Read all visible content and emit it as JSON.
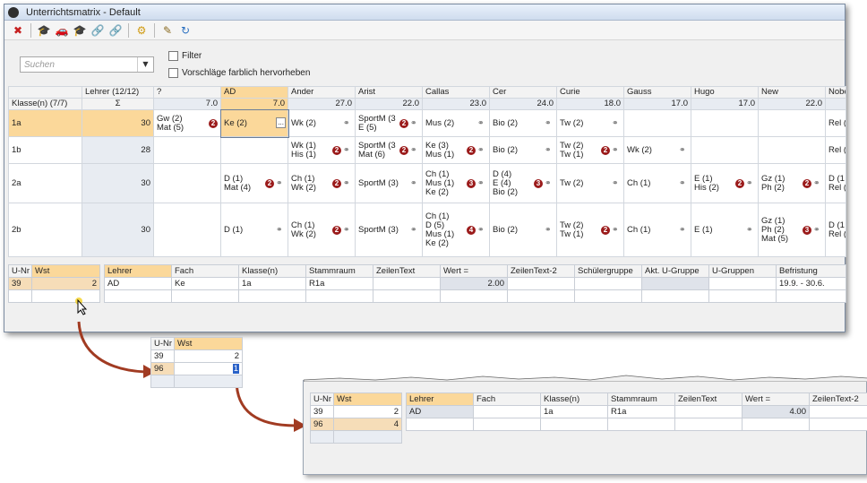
{
  "window": {
    "title": "Unterrichtsmatrix - Default"
  },
  "toolbar": {
    "icons": [
      "delete-icon",
      "graduation-cap-icon",
      "car-icon",
      "graduation-cap-icon",
      "link-icon",
      "link-disabled-icon",
      "settings-gear-icon",
      "edit-icon",
      "refresh-icon"
    ]
  },
  "search": {
    "placeholder": "Suchen"
  },
  "options": {
    "filter": "Filter",
    "highlight": "Vorschläge farblich hervorheben"
  },
  "matrix": {
    "corner": "Klasse(n) (7/7)",
    "lehrer_header": "Lehrer (12/12)",
    "sigma": "Σ",
    "columns": [
      {
        "name": "?",
        "sum": "7.0"
      },
      {
        "name": "AD",
        "sum": "7.0"
      },
      {
        "name": "Ander",
        "sum": "27.0"
      },
      {
        "name": "Arist",
        "sum": "22.0"
      },
      {
        "name": "Callas",
        "sum": "23.0"
      },
      {
        "name": "Cer",
        "sum": "24.0"
      },
      {
        "name": "Curie",
        "sum": "18.0"
      },
      {
        "name": "Gauss",
        "sum": "17.0"
      },
      {
        "name": "Hugo",
        "sum": "17.0"
      },
      {
        "name": "New",
        "sum": "22.0"
      },
      {
        "name": "Nobel",
        "sum": ""
      }
    ],
    "rows": [
      {
        "name": "1a",
        "sum": "30",
        "cells": [
          "Gw (2)\nMat (5)",
          "Ke (2)",
          "Wk (2)",
          "SportM (3\nE (5)",
          "Mus (2)",
          "Bio (2)",
          "Tw (2)",
          "",
          "",
          "",
          "Rel ("
        ]
      },
      {
        "name": "1b",
        "sum": "28",
        "cells": [
          "",
          "",
          "Wk (1)\nHis (1)",
          "SportM (3\nMat (6)",
          "Ke (3)\nMus (1)",
          "Bio (2)",
          "Tw (2)\nTw (1)",
          "Wk (2)",
          "",
          "",
          "Rel ("
        ]
      },
      {
        "name": "2a",
        "sum": "30",
        "cells": [
          "",
          "D (1)\nMat (4)",
          "Ch (1)\nWk (2)",
          "SportM (3)",
          "Ch (1)\nMus (1)\nKe (2)",
          "D (4)\nE (4)\nBio (2)",
          "Tw (2)",
          "Ch (1)",
          "E (1)\nHis (2)",
          "Gz (1)\nPh (2)",
          "D (1\nRel ("
        ]
      },
      {
        "name": "2b",
        "sum": "30",
        "cells": [
          "",
          "D (1)",
          "Ch (1)\nWk (2)",
          "SportM (3)",
          "Ch (1)\nD (5)\nMus (1)\nKe (2)",
          "Bio (2)",
          "Tw (2)\nTw (1)",
          "Ch (1)",
          "E (1)",
          "Gz (1)\nPh (2)\nMat (5)",
          "D (1\nRel ("
        ]
      }
    ]
  },
  "unr_table": {
    "headers": [
      "U-Nr",
      "Wst"
    ],
    "rows": [
      [
        "39",
        "2"
      ]
    ]
  },
  "detail_table": {
    "headers": [
      "Lehrer",
      "Fach",
      "Klasse(n)",
      "Stammraum",
      "ZeilenText",
      "Wert =",
      "ZeilenText-2",
      "Schülergruppe",
      "Akt. U-Gruppe",
      "U-Gruppen",
      "Befristung"
    ],
    "row": [
      "AD",
      "Ke",
      "1a",
      "R1a",
      "",
      "2.00",
      "",
      "",
      "",
      "",
      "19.9. - 30.6."
    ]
  },
  "step2": {
    "headers": [
      "U-Nr",
      "Wst"
    ],
    "rows": [
      [
        "39",
        "2"
      ],
      [
        "96",
        "1"
      ]
    ]
  },
  "step3": {
    "unr_headers": [
      "U-Nr",
      "Wst"
    ],
    "unr_rows": [
      [
        "39",
        "2"
      ],
      [
        "96",
        "4"
      ]
    ],
    "detail_headers": [
      "Lehrer",
      "Fach",
      "Klasse(n)",
      "Stammraum",
      "ZeilenText",
      "Wert =",
      "ZeilenText-2"
    ],
    "detail_row": [
      "AD",
      "",
      "1a",
      "R1a",
      "",
      "4.00",
      ""
    ]
  }
}
